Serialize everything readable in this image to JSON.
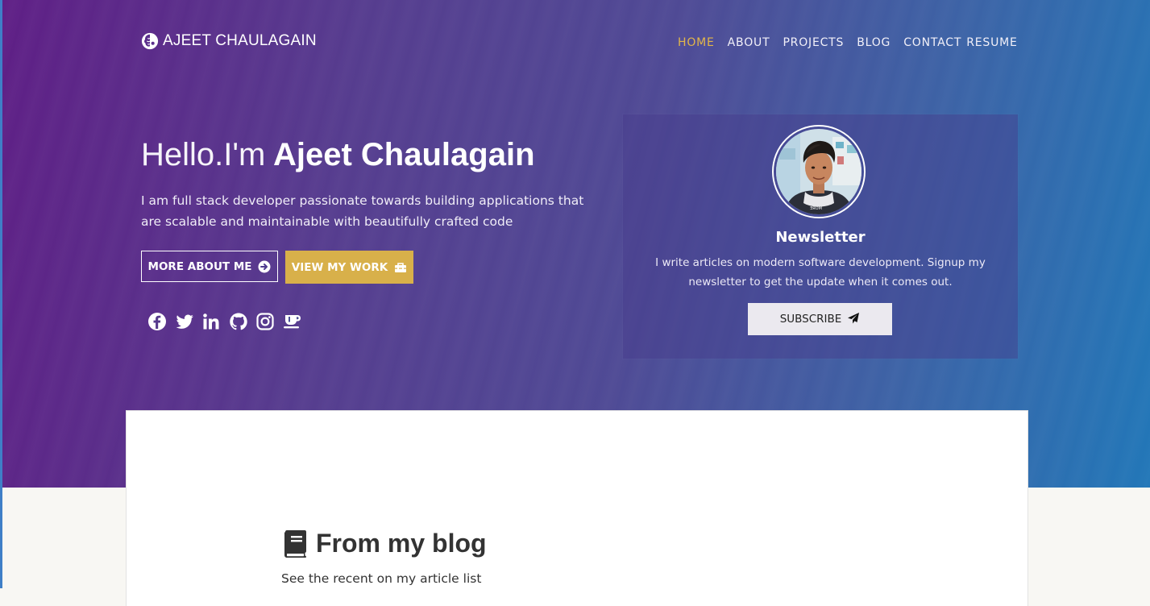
{
  "header": {
    "brand": "AJEET CHAULAGAIN",
    "brand_icon": "brain-logo-icon",
    "nav": [
      "HOME",
      "ABOUT",
      "PROJECTS",
      "BLOG",
      "CONTACT",
      "RESUME"
    ],
    "active_nav": "HOME"
  },
  "intro": {
    "greeting": "Hello.I'm",
    "name": "Ajeet Chaulagain",
    "description": "I am full stack developer passionate towards building applications that are scalable and maintainable with beautifully crafted code",
    "more_button": "MORE ABOUT ME",
    "more_button_icon": "arrow-circle-right-icon",
    "work_button": "VIEW MY WORK",
    "work_button_icon": "toolbox-icon",
    "socials": [
      "facebook-icon",
      "twitter-icon",
      "linkedin-icon",
      "github-icon",
      "instagram-icon",
      "coffee-icon"
    ]
  },
  "newsletter": {
    "title": "Newsletter",
    "text": "I write articles on modern software development. Signup my newsletter to get the update when it comes out.",
    "button": "SUBSCRIBE",
    "button_icon": "paper-plane-icon"
  },
  "blog": {
    "icon": "book-icon",
    "heading": "From my blog",
    "subtitle": "See the recent on my article list"
  },
  "colors": {
    "gradient_start": "#5f1f86",
    "gradient_end": "#2277b8",
    "accent_gold": "#d8b04a",
    "active_nav": "#e3b649"
  }
}
